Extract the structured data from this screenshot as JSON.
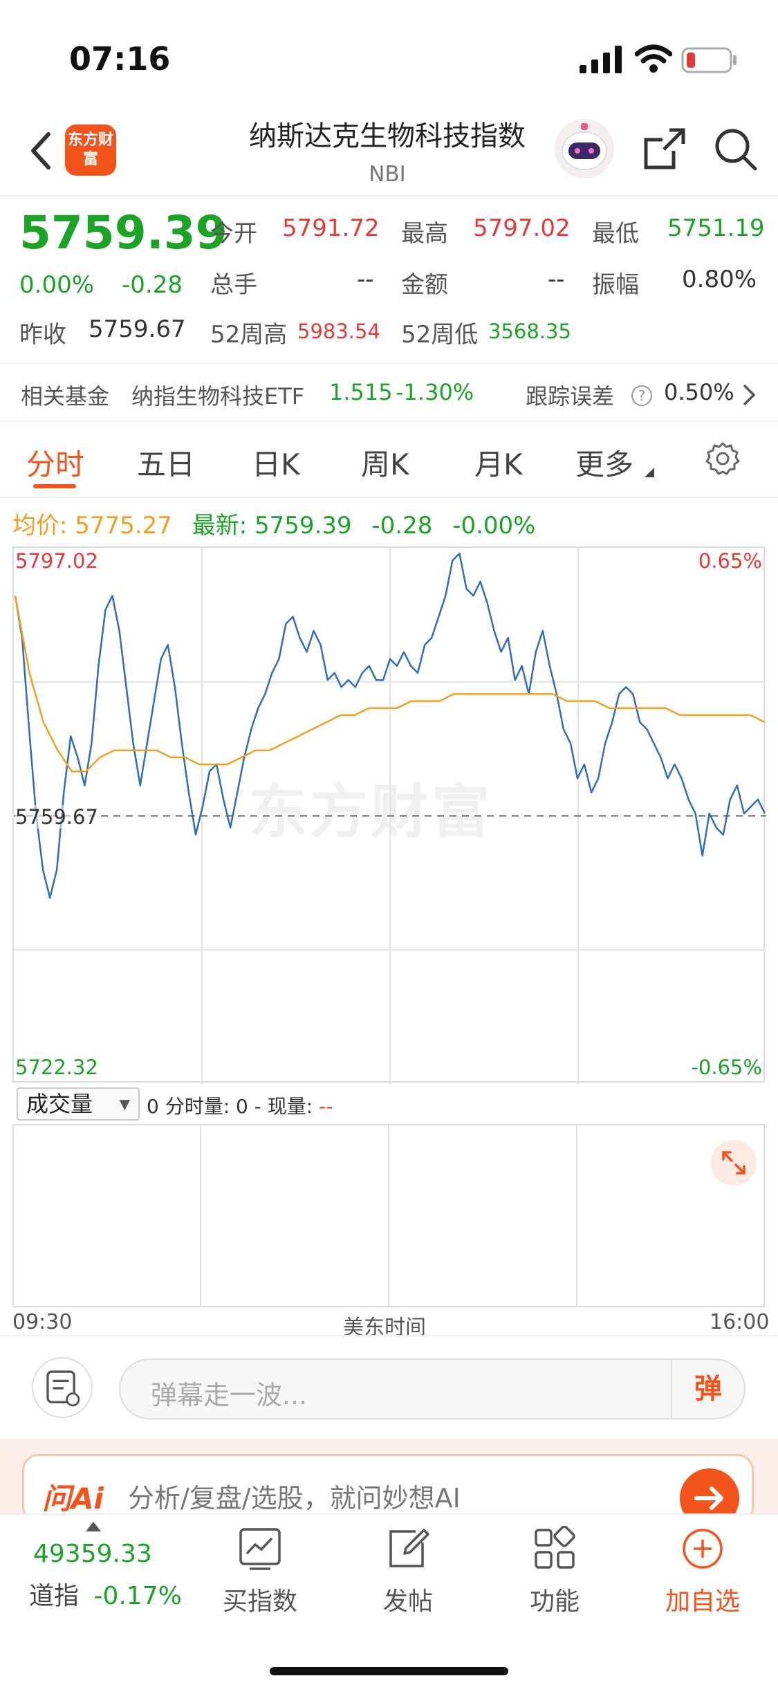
{
  "status_bar": {
    "time": "07:16"
  },
  "header": {
    "logo_text": "东方财富",
    "title": "纳斯达克生物科技指数",
    "code": "NBI"
  },
  "quote": {
    "price": "5759.39",
    "change_pct": "0.00%",
    "change": "-0.28",
    "open_label": "今开",
    "open": "5791.72",
    "high_label": "最高",
    "high": "5797.02",
    "low_label": "最低",
    "low": "5751.19",
    "volume_label": "总手",
    "volume": "--",
    "amount_label": "金额",
    "amount": "--",
    "amplitude_label": "振幅",
    "amplitude": "0.80%",
    "prev_close_label": "昨收",
    "prev_close": "5759.67",
    "wk52_high_label": "52周高",
    "wk52_high": "5983.54",
    "wk52_low_label": "52周低",
    "wk52_low": "3568.35"
  },
  "fund": {
    "label": "相关基金",
    "name": "纳指生物科技ETF",
    "price": "1.515",
    "change": "-1.30%",
    "tracking_label": "跟踪误差",
    "tracking": "0.50%"
  },
  "tabs": [
    "分时",
    "五日",
    "日K",
    "周K",
    "月K",
    "更多"
  ],
  "summary": {
    "avg_label": "均价:",
    "avg": "5775.27",
    "latest_label": "最新:",
    "latest": "5759.39",
    "latest_change": "-0.28",
    "latest_pct": "-0.00%"
  },
  "chart_data": {
    "type": "line",
    "x_start": "09:30",
    "x_end": "16:00",
    "xlabel": "美东时间",
    "ylim": [
      5722.32,
      5797.02
    ],
    "y_top_label": "5797.02",
    "y_mid_label": "5759.67",
    "y_bottom_label": "5722.32",
    "pct_top_label": "0.65%",
    "pct_bottom_label": "-0.65%",
    "reference": 5759.67,
    "series": [
      {
        "values": [
          5791,
          5785,
          5772,
          5760,
          5752,
          5748,
          5752,
          5763,
          5771,
          5768,
          5764,
          5770,
          5781,
          5789,
          5791,
          5786,
          5778,
          5770,
          5764,
          5770,
          5776,
          5782,
          5784,
          5778,
          5770,
          5763,
          5757,
          5761,
          5766,
          5767,
          5762,
          5758,
          5763,
          5768,
          5772,
          5775,
          5777,
          5780,
          5782,
          5787,
          5788,
          5785,
          5783,
          5786,
          5784,
          5779,
          5780,
          5778,
          5779,
          5778,
          5780,
          5781,
          5779,
          5779,
          5782,
          5781,
          5783,
          5781,
          5780,
          5784,
          5785,
          5788,
          5791,
          5796,
          5797,
          5792,
          5791,
          5793,
          5790,
          5786,
          5783,
          5785,
          5779,
          5781,
          5777,
          5783,
          5786,
          5781,
          5777,
          5772,
          5770,
          5765,
          5767,
          5763,
          5765,
          5770,
          5773,
          5777,
          5778,
          5777,
          5773,
          5772,
          5770,
          5768,
          5765,
          5767,
          5765,
          5762,
          5760,
          5754,
          5760,
          5758,
          5757,
          5762,
          5764,
          5760,
          5761,
          5762,
          5760
        ]
      },
      {
        "values": [
          5791,
          5780,
          5773,
          5769,
          5766,
          5766,
          5768,
          5769,
          5769,
          5769,
          5769,
          5768,
          5768,
          5767,
          5767,
          5767,
          5768,
          5769,
          5769,
          5770,
          5771,
          5772,
          5773,
          5774,
          5774,
          5775,
          5775,
          5775,
          5776,
          5776,
          5776,
          5777,
          5777,
          5777,
          5777,
          5777,
          5777,
          5777,
          5777,
          5776,
          5776,
          5776,
          5775,
          5775,
          5775,
          5775,
          5775,
          5774,
          5774,
          5774,
          5774,
          5774,
          5774,
          5773
        ]
      }
    ]
  },
  "volume": {
    "selector": "成交量",
    "info_prefix": "0 分时量: 0 - 现量:",
    "info_value": "--"
  },
  "comment": {
    "placeholder": "弹幕走一波...",
    "send": "弹"
  },
  "ai": {
    "logo": "问Ai",
    "placeholder": "分析/复盘/选股，就问妙想AI"
  },
  "bottom_nav": {
    "index_value": "49359.33",
    "index_name": "道指",
    "index_change": "-0.17%",
    "items": [
      "买指数",
      "发帖",
      "功能",
      "加自选"
    ]
  },
  "colors": {
    "up": "#e53935",
    "down": "#1aa326",
    "accent": "#f2541b",
    "price_line": "#2f6db5",
    "avg_line": "#f0a020"
  }
}
